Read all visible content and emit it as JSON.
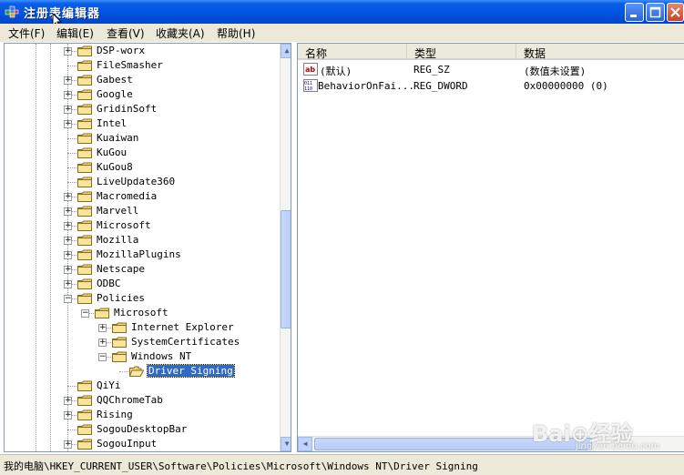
{
  "window": {
    "title": "注册表编辑器"
  },
  "menu": [
    {
      "label": "文件(F)"
    },
    {
      "label": "编辑(E)"
    },
    {
      "label": "查看(V)"
    },
    {
      "label": "收藏夹(A)"
    },
    {
      "label": "帮助(H)"
    }
  ],
  "tree": {
    "nodes": [
      {
        "label": "DSP-worx",
        "level": 0,
        "expander": "+"
      },
      {
        "label": "FileSmasher",
        "level": 0,
        "expander": ""
      },
      {
        "label": "Gabest",
        "level": 0,
        "expander": "+"
      },
      {
        "label": "Google",
        "level": 0,
        "expander": "+"
      },
      {
        "label": "GridinSoft",
        "level": 0,
        "expander": "+"
      },
      {
        "label": "Intel",
        "level": 0,
        "expander": "+"
      },
      {
        "label": "Kuaiwan",
        "level": 0,
        "expander": ""
      },
      {
        "label": "KuGou",
        "level": 0,
        "expander": ""
      },
      {
        "label": "KuGou8",
        "level": 0,
        "expander": ""
      },
      {
        "label": "LiveUpdate360",
        "level": 0,
        "expander": ""
      },
      {
        "label": "Macromedia",
        "level": 0,
        "expander": "+"
      },
      {
        "label": "Marvell",
        "level": 0,
        "expander": "+"
      },
      {
        "label": "Microsoft",
        "level": 0,
        "expander": "+"
      },
      {
        "label": "Mozilla",
        "level": 0,
        "expander": "+"
      },
      {
        "label": "MozillaPlugins",
        "level": 0,
        "expander": "+"
      },
      {
        "label": "Netscape",
        "level": 0,
        "expander": "+"
      },
      {
        "label": "ODBC",
        "level": 0,
        "expander": "+"
      },
      {
        "label": "Policies",
        "level": 0,
        "expander": "-"
      },
      {
        "label": "Microsoft",
        "level": 1,
        "expander": "-"
      },
      {
        "label": "Internet Explorer",
        "level": 2,
        "expander": "+"
      },
      {
        "label": "SystemCertificates",
        "level": 2,
        "expander": "+"
      },
      {
        "label": "Windows NT",
        "level": 2,
        "expander": "-"
      },
      {
        "label": "Driver Signing",
        "level": 3,
        "expander": "",
        "selected": true
      },
      {
        "label": "QiYi",
        "level": 0,
        "expander": ""
      },
      {
        "label": "QQChromeTab",
        "level": 0,
        "expander": "+"
      },
      {
        "label": "Rising",
        "level": 0,
        "expander": "+"
      },
      {
        "label": "SogouDesktopBar",
        "level": 0,
        "expander": ""
      },
      {
        "label": "SogouInput",
        "level": 0,
        "expander": "+"
      }
    ]
  },
  "list": {
    "columns": [
      "名称",
      "类型",
      "数据"
    ],
    "rows": [
      {
        "icon": "string-value-icon",
        "name": "(默认)",
        "type": "REG_SZ",
        "data": "(数值未设置)"
      },
      {
        "icon": "dword-value-icon",
        "name": "BehaviorOnFai...",
        "type": "REG_DWORD",
        "data": "0x00000000 (0)"
      }
    ]
  },
  "status": {
    "path": "我的电脑\\HKEY_CURRENT_USER\\Software\\Policies\\Microsoft\\Windows NT\\Driver Signing"
  },
  "watermark": {
    "text": "Bai⊕经验",
    "sub": "jingyan.baidu.com"
  },
  "colors": {
    "titlebar": "#0054e3",
    "selection": "#316ac5",
    "folder": "#f5d77a",
    "chrome": "#ece9d8"
  }
}
